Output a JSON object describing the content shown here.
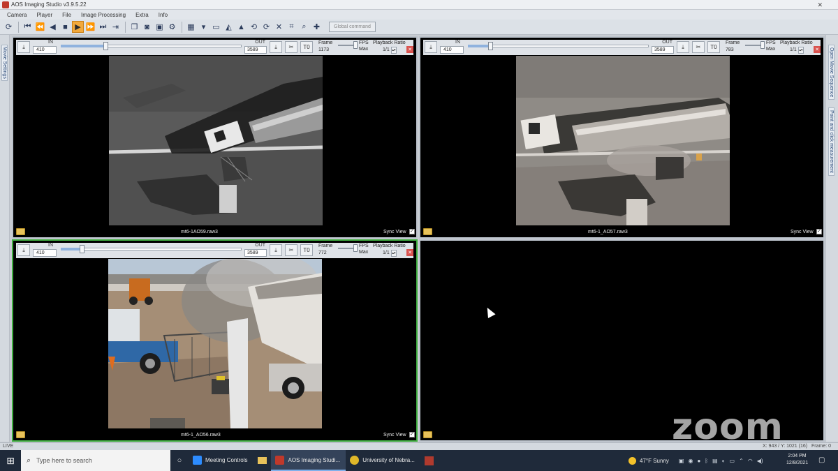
{
  "window": {
    "title": "AOS Imaging Studio v3.9.5.22",
    "close": "✕"
  },
  "menu": [
    "Camera",
    "Player",
    "File",
    "Image Processing",
    "Extra",
    "Info"
  ],
  "toolbar": {
    "global_command": "Global command"
  },
  "side_tabs": {
    "left": "Movie Settings",
    "right": [
      "Open Movie Sequence",
      "Point and click measurement"
    ]
  },
  "panels": [
    {
      "in_label": "IN",
      "in_value": "410",
      "out_label": "OUT",
      "out_value": "3589",
      "frame_label": "Frame",
      "frame_value": "1173",
      "fps_label": "FPS",
      "fps_max": "Max",
      "ratio_label": "Playback Ratio",
      "ratio_value": "1/1",
      "t0_label": "T0",
      "filename": "mt6-1AO59.raw3",
      "sync_label": "Sync View",
      "in_progress": 0.25
    },
    {
      "in_label": "IN",
      "in_value": "410",
      "out_label": "OUT",
      "out_value": "3589",
      "frame_label": "Frame",
      "frame_value": "783",
      "fps_label": "FPS",
      "fps_max": "Max",
      "ratio_label": "Playback Ratio",
      "ratio_value": "1/1",
      "t0_label": "T0",
      "filename": "mt6-1_AO57.raw3",
      "sync_label": "Sync View",
      "in_progress": 0.13
    },
    {
      "in_label": "IN",
      "in_value": "410",
      "out_label": "OUT",
      "out_value": "3589",
      "frame_label": "Frame",
      "frame_value": "772",
      "fps_label": "FPS",
      "fps_max": "Max",
      "ratio_label": "Playback Ratio",
      "ratio_value": "1/1",
      "t0_label": "T0",
      "filename": "mt6-1_AO56.raw3",
      "sync_label": "Sync View",
      "in_progress": 0.12
    }
  ],
  "status": {
    "live": "LIVE",
    "coords": "X: 943 / Y: 1021 (16)",
    "frame": "Frame: 0"
  },
  "watermark": "zoom",
  "taskbar": {
    "search_placeholder": "Type here to search",
    "apps": [
      "Meeting Controls",
      "AOS Imaging Studi...",
      "University of Nebra..."
    ],
    "weather": "47°F  Sunny",
    "time": "2:04 PM",
    "date": "12/8/2021"
  },
  "colors": {
    "active_border": "#3fae3f",
    "play_button": "#f2a93b",
    "taskbar": "#1f2a3a"
  }
}
